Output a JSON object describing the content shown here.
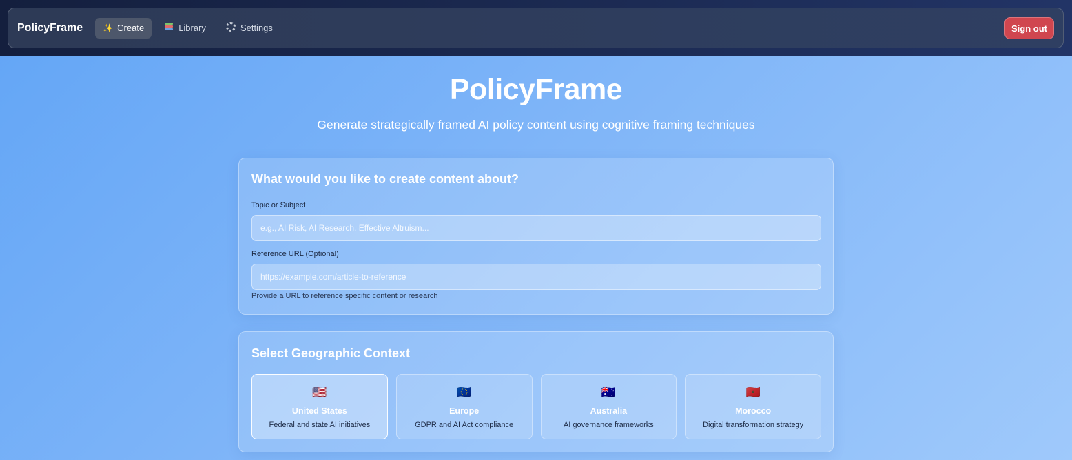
{
  "nav": {
    "brand": "PolicyFrame",
    "items": [
      {
        "label": "Create",
        "icon": "sparkles-icon",
        "glyph": "✨",
        "active": true
      },
      {
        "label": "Library",
        "icon": "books-icon",
        "active": false
      },
      {
        "label": "Settings",
        "icon": "gear-icon",
        "active": false
      }
    ],
    "signout_label": "Sign out"
  },
  "hero": {
    "title": "PolicyFrame",
    "subtitle": "Generate strategically framed AI policy content using cognitive framing techniques"
  },
  "content_card": {
    "heading": "What would you like to create content about?",
    "topic": {
      "label": "Topic or Subject",
      "placeholder": "e.g., AI Risk, AI Research, Effective Altruism...",
      "value": ""
    },
    "reference": {
      "label": "Reference URL (Optional)",
      "placeholder": "https://example.com/article-to-reference",
      "value": "",
      "hint": "Provide a URL to reference specific content or research"
    }
  },
  "geo_card": {
    "heading": "Select Geographic Context",
    "regions": [
      {
        "flag": "🇺🇸",
        "name": "United States",
        "desc": "Federal and state AI initiatives",
        "selected": true
      },
      {
        "flag": "🇪🇺",
        "name": "Europe",
        "desc": "GDPR and AI Act compliance",
        "selected": false
      },
      {
        "flag": "🇦🇺",
        "name": "Australia",
        "desc": "AI governance frameworks",
        "selected": false
      },
      {
        "flag": "🇲🇦",
        "name": "Morocco",
        "desc": "Digital transformation strategy",
        "selected": false
      }
    ]
  },
  "colors": {
    "signout": "#d0464f",
    "nav_bg": "#2d3a56",
    "page_gradient_start": "#62a5f6",
    "page_gradient_end": "#9fc9fb"
  }
}
